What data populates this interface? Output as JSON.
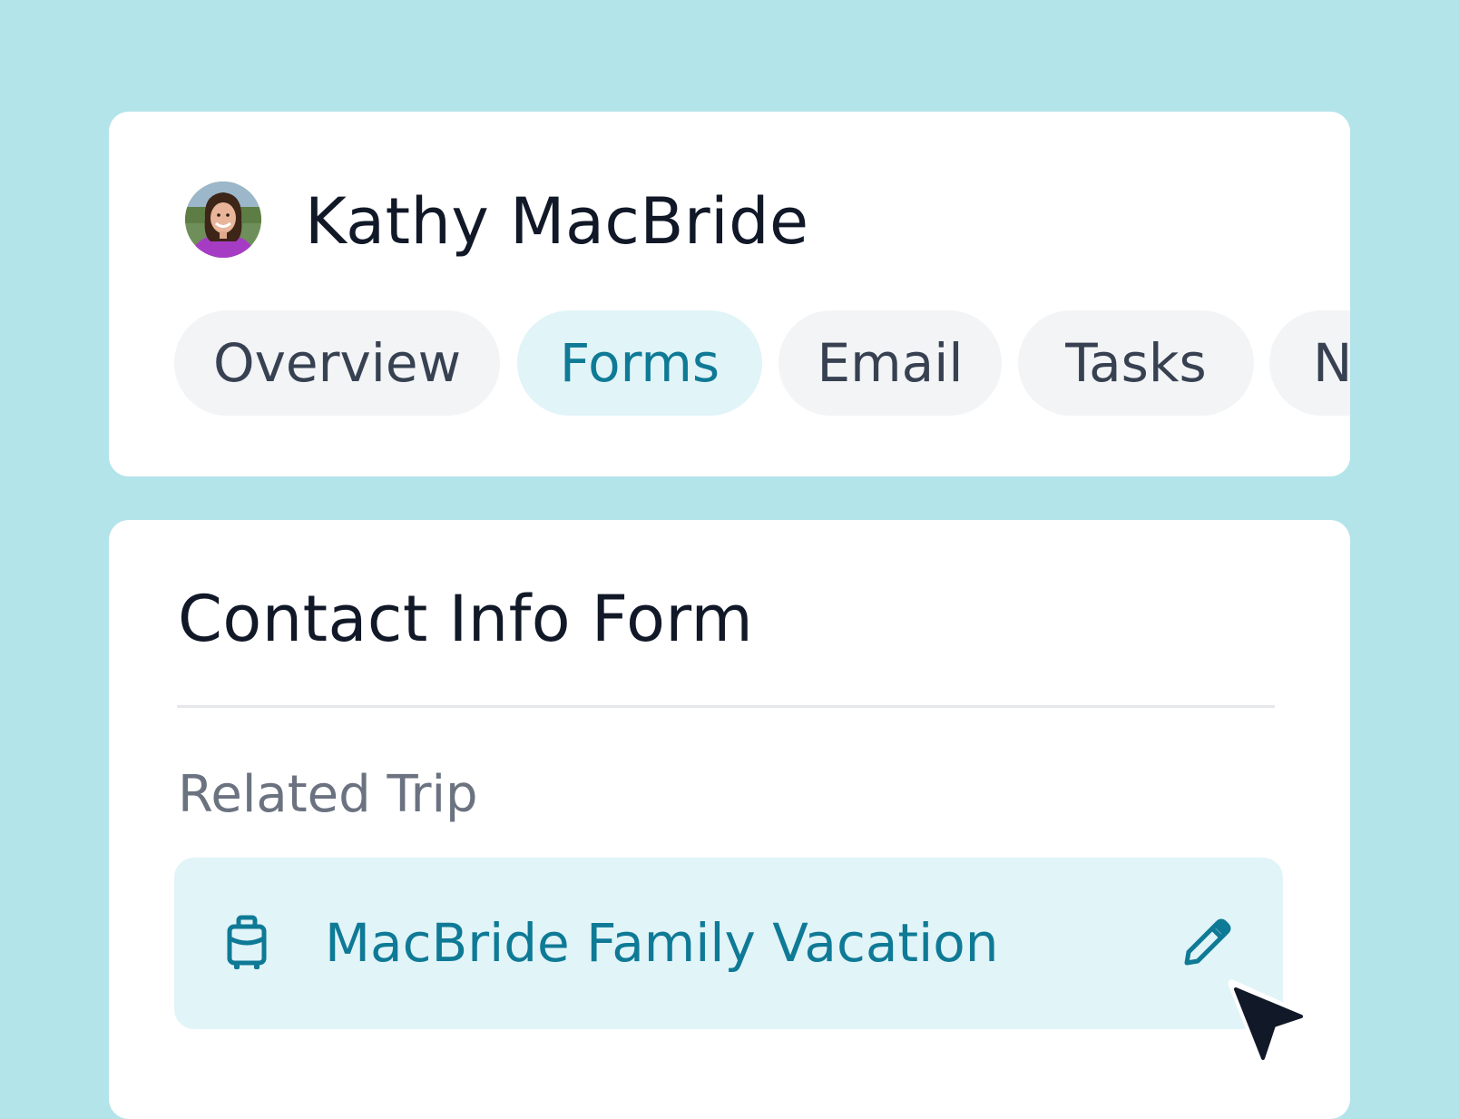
{
  "contact": {
    "name": "Kathy MacBride",
    "avatar_icon": "user-photo-avatar"
  },
  "tabs": [
    {
      "label": "Overview",
      "active": false
    },
    {
      "label": "Forms",
      "active": true
    },
    {
      "label": "Email",
      "active": false
    },
    {
      "label": "Tasks",
      "active": false
    },
    {
      "label": "N",
      "active": false
    }
  ],
  "form": {
    "title": "Contact Info Form",
    "related_trip_label": "Related Trip",
    "trip": {
      "name": "MacBride Family Vacation",
      "icon": "luggage-icon",
      "edit_icon": "pencil-icon"
    }
  },
  "colors": {
    "background": "#b3e4ea",
    "accent": "#0f7a96",
    "active_tab_bg": "#e1f4f8",
    "tab_bg": "#f2f4f6"
  }
}
